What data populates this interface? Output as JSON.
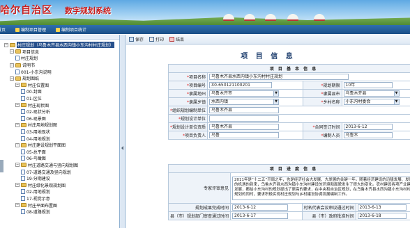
{
  "header": {
    "title": "哈尔自治区",
    "subtitle": "数字规划系统"
  },
  "nav": {
    "items": [
      {
        "label": "首页"
      },
      {
        "label": "编制项目管理"
      },
      {
        "label": "编制项目统计"
      }
    ]
  },
  "tree": {
    "root": "村庄规划（乌鲁木齐县水西沟镇小东沟村村庄规划）",
    "items": [
      {
        "level": 1,
        "type": "folder",
        "label": "项目信息"
      },
      {
        "level": 2,
        "type": "doc",
        "label": "村庄规划"
      },
      {
        "level": 1,
        "type": "folder",
        "label": "说明书"
      },
      {
        "level": 2,
        "type": "doc",
        "label": "001-小东沟说明"
      },
      {
        "level": 1,
        "type": "folder",
        "label": "规划图纸"
      },
      {
        "level": 2,
        "type": "folder",
        "label": "村庄位置图"
      },
      {
        "level": 3,
        "type": "doc",
        "label": "00-封面"
      },
      {
        "level": 3,
        "type": "doc",
        "label": "01-区位"
      },
      {
        "level": 2,
        "type": "folder",
        "label": "村庄现状图"
      },
      {
        "level": 3,
        "type": "doc",
        "label": "02-现状分析"
      },
      {
        "level": 3,
        "type": "doc",
        "label": "06-现景图"
      },
      {
        "level": 2,
        "type": "folder",
        "label": "村庄用地规划图"
      },
      {
        "level": 3,
        "type": "doc",
        "label": "03-用地现状"
      },
      {
        "level": 3,
        "type": "doc",
        "label": "04-用地规划"
      },
      {
        "level": 2,
        "type": "folder",
        "label": "村庄建设规划平面图"
      },
      {
        "level": 3,
        "type": "doc",
        "label": "05-总平面"
      },
      {
        "level": 3,
        "type": "doc",
        "label": "06-鸟瞰图"
      },
      {
        "level": 2,
        "type": "folder",
        "label": "村庄道路交通与竖向规划图"
      },
      {
        "level": 3,
        "type": "doc",
        "label": "07-道路交通及竖向规划"
      },
      {
        "level": 3,
        "type": "doc",
        "label": "19-分期建设"
      },
      {
        "level": 2,
        "type": "folder",
        "label": "村庄绿化景观规划图"
      },
      {
        "level": 3,
        "type": "doc",
        "label": "02-用地规划"
      },
      {
        "level": 3,
        "type": "doc",
        "label": "17-视觉示意"
      },
      {
        "level": 2,
        "type": "folder",
        "label": "村庄平面布置图"
      },
      {
        "level": 3,
        "type": "doc",
        "label": "08-道路规划"
      }
    ]
  },
  "toolbar": {
    "save": "保存",
    "print": "打印",
    "close": "结束"
  },
  "page_title": "项 目 信 息",
  "basic": {
    "section": "项 目 基 本 信 息",
    "project_name_label": "项目名称",
    "project_name": "乌鲁木齐县水西沟镇小东沟村村庄规划",
    "project_no_label": "项目编号",
    "project_no": "X0-650121100201",
    "plan_period_label": "规划期限",
    "plan_period": "10年",
    "region_label": "隶属地州",
    "region": "乌鲁木齐市",
    "county_label": "隶属县市",
    "county": "乌鲁木齐县",
    "township_label": "隶属乡镇",
    "township": "水西沟镇",
    "village_label": "乡村名称",
    "village": "小东沟村委会",
    "org_label": "组织规划编制单位",
    "org": "乌鲁木齐县",
    "design_label": "规划设计单位",
    "design": "",
    "fee_label": "规划设计单位资质",
    "fee": "乌鲁木齐县",
    "contract_label": "合同签订时间",
    "contract": "2013-6-12",
    "leader_label": "项目负责人",
    "leader": "乌鲁",
    "editor_label": "编制人员",
    "editor": "乌鲁木"
  },
  "progress": {
    "section": "项 目 进 度 信 息",
    "review_label": "专家评审意见",
    "review_text": "2011年是“十二五”开局之年，也是经济社会大发展、大发展的关键一年。随着经济建设的迅猛发展、发展的机遇的到来，乌鲁木齐县水西沟镇小东沟村建设的环境和面貌发生了很大的变化。农村建设各项产业建设发展，都给小东沟村的规划提出了更高的要求，在中央和自治区规划，在乌鲁木齐县水西沟镇小东沟村村庄规划的同时，要求积极实现村庄规划与乡村建设协调发展编制工作。",
    "done_label": "规划成果完成时间",
    "done": "2013-6-12",
    "meeting_label": "村名代表会议审议通过时间",
    "meeting": "2013-6-13",
    "dept_label": "县（市）规划部门审查通过时间",
    "dept": "2013-6-17",
    "gov_label": "县（市）政府批准时间",
    "gov": "2013-6-18"
  }
}
